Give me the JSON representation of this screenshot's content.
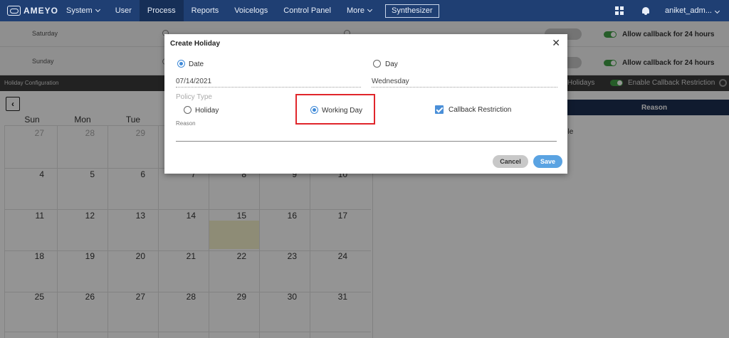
{
  "navbar": {
    "logo_text": "AMEYO",
    "items": [
      {
        "label": "System",
        "dropdown": true
      },
      {
        "label": "User",
        "dropdown": false
      },
      {
        "label": "Process",
        "dropdown": false,
        "active": true
      },
      {
        "label": "Reports",
        "dropdown": false
      },
      {
        "label": "Voicelogs",
        "dropdown": false
      },
      {
        "label": "Control Panel",
        "dropdown": false
      },
      {
        "label": "More",
        "dropdown": true
      }
    ],
    "synth_label": "Synthesizer",
    "user_name": "aniket_adm...",
    "icons": [
      "apps-grid-icon",
      "bell-icon",
      "chevron-down-icon"
    ]
  },
  "background": {
    "rows": [
      {
        "day": "Saturday",
        "callback_label": "Allow callback for 24 hours"
      },
      {
        "day": "Sunday",
        "callback_label": "Allow callback for 24 hours"
      }
    ],
    "config_title": "Holiday Configuration",
    "holidays_label": "Holidays",
    "enable_restriction_label": "Enable Callback Restriction",
    "reason_header": "Reason",
    "reason_fragment": "ble",
    "weekdays": [
      "Sun",
      "Mon",
      "Tue",
      "",
      "",
      "",
      ""
    ],
    "calendar_rows": [
      [
        "27",
        "28",
        "29",
        "",
        "",
        "",
        ""
      ],
      [
        "4",
        "5",
        "6",
        "7",
        "8",
        "9",
        "10"
      ],
      [
        "11",
        "12",
        "13",
        "14",
        "15",
        "16",
        "17"
      ],
      [
        "18",
        "19",
        "20",
        "21",
        "22",
        "23",
        "24"
      ],
      [
        "25",
        "26",
        "27",
        "28",
        "29",
        "30",
        "31"
      ]
    ]
  },
  "modal": {
    "title": "Create Holiday",
    "date_label": "Date",
    "day_label": "Day",
    "date_value": "07/14/2021",
    "day_value": "Wednesday",
    "policy_type_label": "Policy Type",
    "holiday_label": "Holiday",
    "working_day_label": "Working Day",
    "callback_restriction_label": "Callback Restriction",
    "reason_label": "Reason",
    "cancel_label": "Cancel",
    "save_label": "Save",
    "colors": {
      "accent": "#3f8ad8",
      "highlight": "#e0262b",
      "navbar": "#1f3f73"
    }
  }
}
